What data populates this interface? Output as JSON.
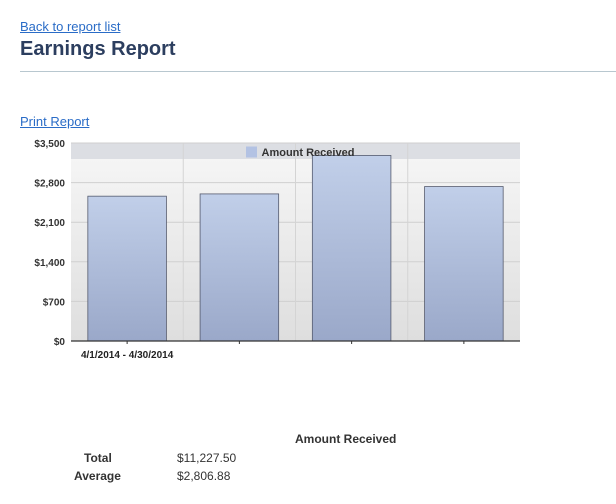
{
  "nav": {
    "back_link": "Back to report list",
    "print_link": "Print Report"
  },
  "page": {
    "title": "Earnings Report"
  },
  "chart_data": {
    "type": "bar",
    "legend": "Amount Received",
    "legend_position": "top-center",
    "categories": [
      "4/1/2014 - 4/30/2014",
      "",
      "",
      ""
    ],
    "values": [
      2560,
      2600,
      3280,
      2730
    ],
    "ylim": [
      0,
      3500
    ],
    "y_ticks": [
      0,
      700,
      1400,
      2100,
      2800,
      3500
    ],
    "y_tick_labels": [
      "$0",
      "$700",
      "$1,400",
      "$2,100",
      "$2,800",
      "$3,500"
    ],
    "grid": true,
    "colors": {
      "bar_top": "#c1cfe9",
      "bar_bottom": "#9aa8c9",
      "bar_stroke": "#555b6e",
      "legend_band": "#dcdee3"
    }
  },
  "summary": {
    "column_header": "Amount Received",
    "rows": [
      {
        "label": "Total",
        "value": "$11,227.50"
      },
      {
        "label": "Average",
        "value": "$2,806.88"
      }
    ]
  }
}
